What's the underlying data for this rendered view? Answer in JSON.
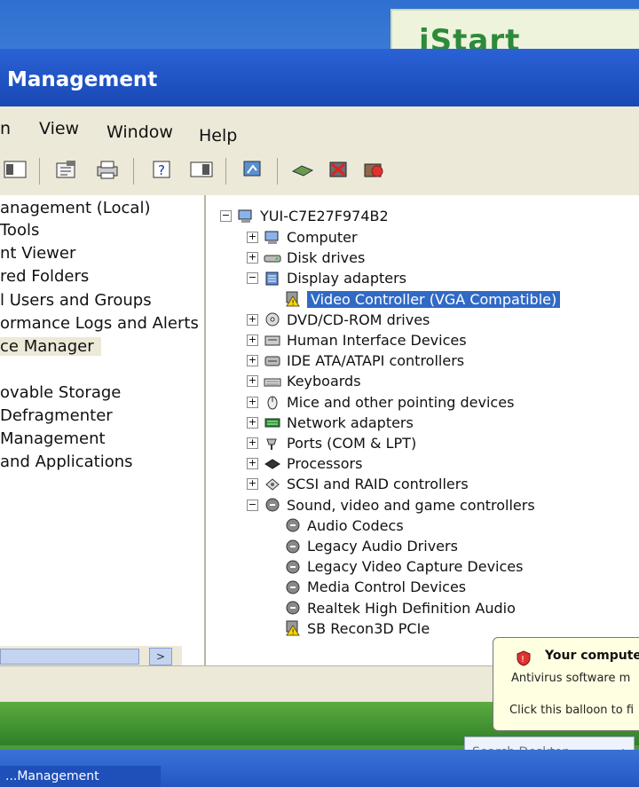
{
  "desktop": {
    "istart_label": "iStart",
    "istart_arrow": "<",
    "taskbar_item": "...Management",
    "search_placeholder": "Search Desktop"
  },
  "window": {
    "title": "Management",
    "menu": [
      "n",
      "View",
      "Window",
      "Help"
    ]
  },
  "left_tree": [
    {
      "label": "anagement (Local)"
    },
    {
      "label": "Tools"
    },
    {
      "label": "nt Viewer"
    },
    {
      "label": "red Folders"
    },
    {
      "label": "l Users and Groups"
    },
    {
      "label": "ormance Logs and Alerts"
    },
    {
      "label": "ce Manager",
      "selected": true
    },
    {
      "label": ""
    },
    {
      "label": "ovable Storage"
    },
    {
      "label": "Defragmenter"
    },
    {
      "label": "Management"
    },
    {
      "label": "and Applications"
    }
  ],
  "device_tree": {
    "root": "YUI-C7E27F974B2",
    "root_expander": "−",
    "nodes": [
      {
        "label": "Computer",
        "expander": "+",
        "icon": "computer-icon"
      },
      {
        "label": "Disk drives",
        "expander": "+",
        "icon": "disk-drive-icon"
      },
      {
        "label": "Display adapters",
        "expander": "−",
        "icon": "display-adapter-icon"
      },
      {
        "label": "Video Controller (VGA Compatible)",
        "child": true,
        "selected": true,
        "icon": "warning-device-icon"
      },
      {
        "label": "DVD/CD-ROM drives",
        "expander": "+",
        "icon": "cd-drive-icon"
      },
      {
        "label": "Human Interface Devices",
        "expander": "+",
        "icon": "hid-icon"
      },
      {
        "label": "IDE ATA/ATAPI controllers",
        "expander": "+",
        "icon": "ide-controller-icon"
      },
      {
        "label": "Keyboards",
        "expander": "+",
        "icon": "keyboard-icon"
      },
      {
        "label": "Mice and other pointing devices",
        "expander": "+",
        "icon": "mouse-icon"
      },
      {
        "label": "Network adapters",
        "expander": "+",
        "icon": "network-adapter-icon"
      },
      {
        "label": "Ports (COM & LPT)",
        "expander": "+",
        "icon": "port-icon"
      },
      {
        "label": "Processors",
        "expander": "+",
        "icon": "processor-icon"
      },
      {
        "label": "SCSI and RAID controllers",
        "expander": "+",
        "icon": "scsi-icon"
      },
      {
        "label": "Sound, video and game controllers",
        "expander": "−",
        "icon": "sound-icon"
      },
      {
        "label": "Audio Codecs",
        "child": true,
        "icon": "sound-device-icon"
      },
      {
        "label": "Legacy Audio Drivers",
        "child": true,
        "icon": "sound-device-icon"
      },
      {
        "label": "Legacy Video Capture Devices",
        "child": true,
        "icon": "sound-device-icon"
      },
      {
        "label": "Media Control Devices",
        "child": true,
        "icon": "sound-device-icon"
      },
      {
        "label": "Realtek High Definition Audio",
        "child": true,
        "icon": "sound-device-icon"
      },
      {
        "label": "SB Recon3D PCIe",
        "child": true,
        "icon": "warning-device-icon"
      }
    ]
  },
  "balloon": {
    "title": "Your compute",
    "line1": "Antivirus software m",
    "line2": "Click this balloon to fi"
  },
  "colors": {
    "selection": "#316ac5",
    "titlebar": "#1848b4",
    "chrome": "#ece9d8"
  }
}
